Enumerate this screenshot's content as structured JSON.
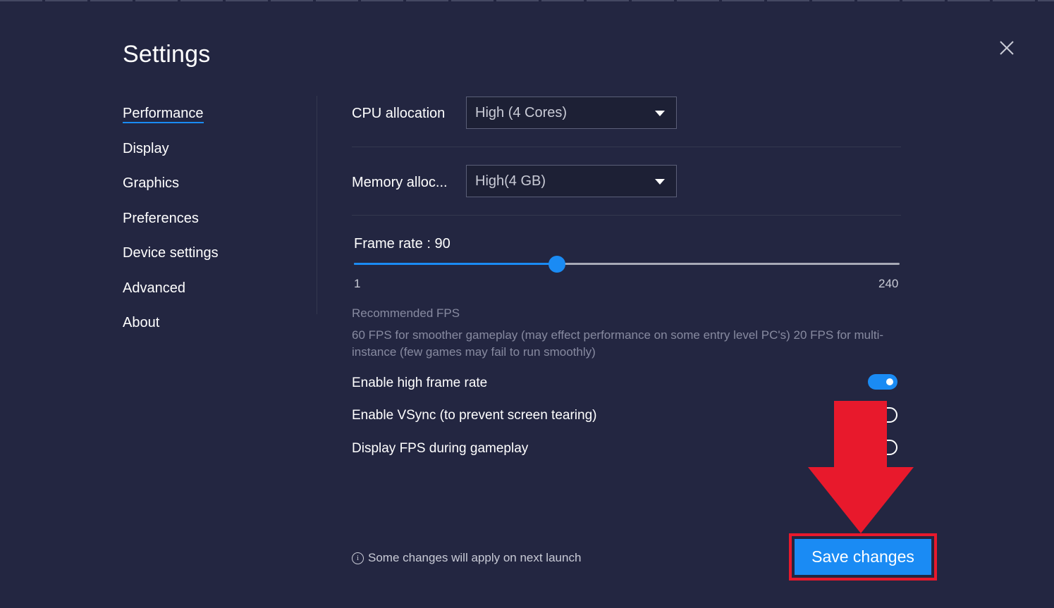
{
  "title": "Settings",
  "nav": {
    "items": [
      {
        "label": "Performance",
        "active": true
      },
      {
        "label": "Display"
      },
      {
        "label": "Graphics"
      },
      {
        "label": "Preferences"
      },
      {
        "label": "Device settings"
      },
      {
        "label": "Advanced"
      },
      {
        "label": "About"
      }
    ]
  },
  "performance": {
    "cpu": {
      "label": "CPU allocation",
      "value": "High (4 Cores)"
    },
    "memory": {
      "label": "Memory alloc...",
      "value": "High(4 GB)"
    },
    "frame_rate": {
      "label": "Frame rate : 90",
      "value": 90,
      "min": 1,
      "max": 240,
      "min_label": "1",
      "max_label": "240"
    },
    "recommended": {
      "title": "Recommended FPS",
      "description": "60 FPS for smoother gameplay (may effect performance on some entry level PC's) 20 FPS for multi-instance (few games may fail to run smoothly)"
    },
    "toggles": [
      {
        "label": "Enable high frame rate",
        "on": true
      },
      {
        "label": "Enable VSync (to prevent screen tearing)",
        "on": false
      },
      {
        "label": "Display FPS during gameplay",
        "on": false
      }
    ]
  },
  "footer": {
    "note": "Some changes will apply on next launch",
    "save_label": "Save changes"
  },
  "colors": {
    "background": "#232641",
    "accent": "#1a8bf4",
    "annotation": "#e8192c",
    "muted_text": "#878aa0"
  },
  "icons": {
    "close": "close-icon",
    "dropdown": "caret-down-icon",
    "info": "info-icon",
    "annotation": "arrow-down-icon"
  }
}
